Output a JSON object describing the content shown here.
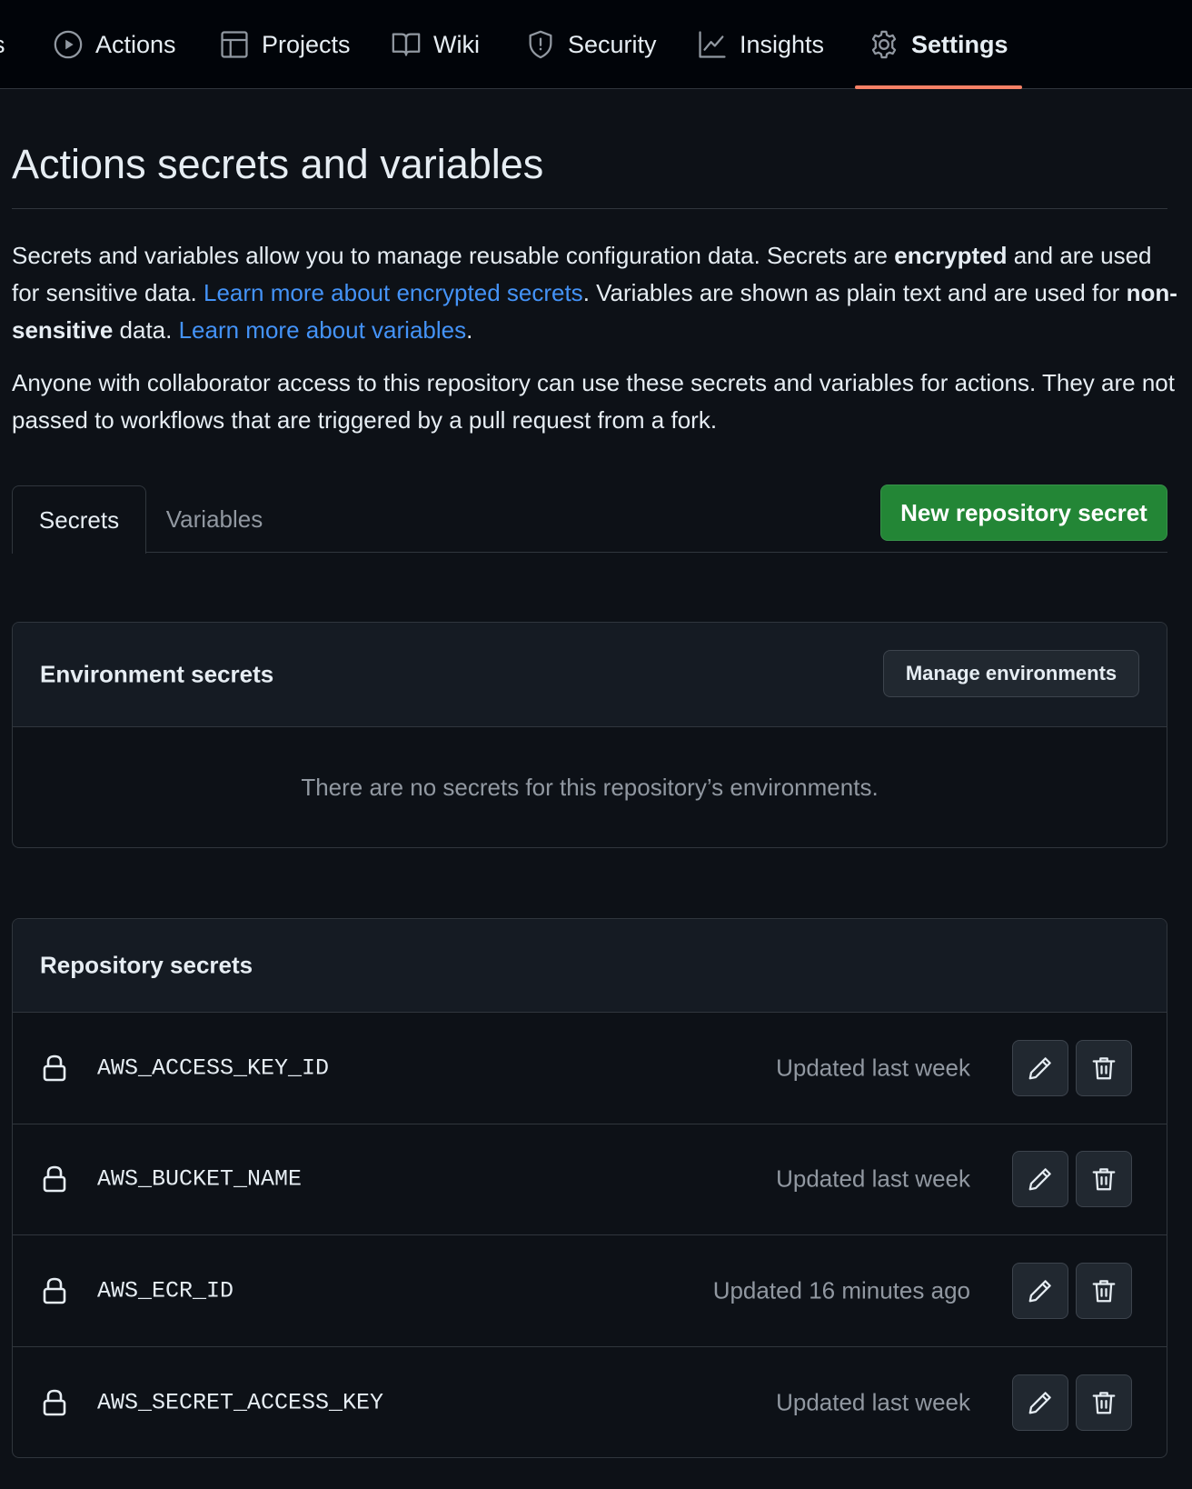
{
  "nav": {
    "partial_label": "s",
    "items": [
      {
        "label": "Actions",
        "icon": "play-circle-icon"
      },
      {
        "label": "Projects",
        "icon": "table-icon"
      },
      {
        "label": "Wiki",
        "icon": "book-icon"
      },
      {
        "label": "Security",
        "icon": "shield-icon"
      },
      {
        "label": "Insights",
        "icon": "graph-icon"
      },
      {
        "label": "Settings",
        "icon": "gear-icon",
        "active": true
      }
    ]
  },
  "page": {
    "title": "Actions secrets and variables",
    "intro": {
      "part1": "Secrets and variables allow you to manage reusable configuration data. Secrets are ",
      "bold1": "encrypted",
      "part2": " and are used for sensitive data. ",
      "link1": "Learn more about encrypted secrets",
      "part3": ". Variables are shown as plain text and are used for ",
      "bold2": "non-sensitive",
      "part4": " data. ",
      "link2": "Learn more about variables",
      "part5": "."
    },
    "note": "Anyone with collaborator access to this repository can use these secrets and variables for actions. They are not passed to workflows that are triggered by a pull request from a fork."
  },
  "tabs": {
    "secrets": "Secrets",
    "variables": "Variables",
    "active": "secrets"
  },
  "new_secret_button": "New repository secret",
  "environment": {
    "title": "Environment secrets",
    "manage_button": "Manage environments",
    "empty_message": "There are no secrets for this repository’s environments."
  },
  "repository": {
    "title": "Repository secrets",
    "secrets": [
      {
        "name": "AWS_ACCESS_KEY_ID",
        "updated": "Updated last week"
      },
      {
        "name": "AWS_BUCKET_NAME",
        "updated": "Updated last week"
      },
      {
        "name": "AWS_ECR_ID",
        "updated": "Updated 16 minutes ago"
      },
      {
        "name": "AWS_SECRET_ACCESS_KEY",
        "updated": "Updated last week"
      }
    ]
  },
  "colors": {
    "accent_underline": "#f78166",
    "primary_button": "#238636",
    "link": "#4493f8",
    "background": "#0d1117"
  }
}
